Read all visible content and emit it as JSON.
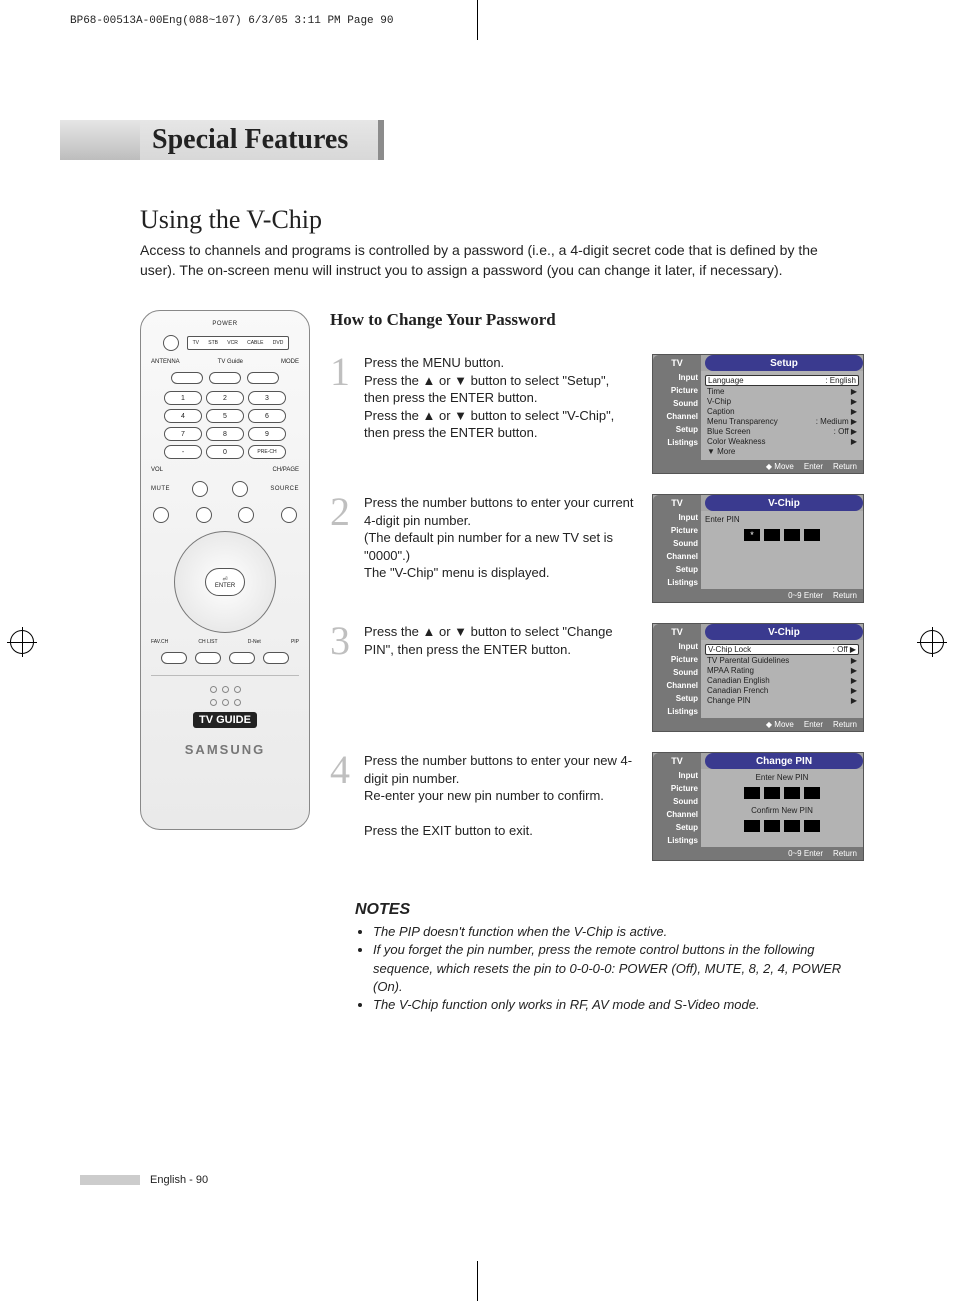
{
  "header": "BP68-00513A-00Eng(088~107)  6/3/05  3:11 PM  Page 90",
  "sectionTitle": "Special Features",
  "subsection": "Using the V-Chip",
  "intro": "Access to channels and programs is controlled by a password (i.e., a 4-digit secret code that is defined by the user). The on-screen menu will instruct you to assign a password (you can change it later, if necessary).",
  "stepsTitle": "How to Change Your Password",
  "steps": [
    {
      "n": "1",
      "text": "Press the MENU button.\nPress the ▲ or ▼ button to select \"Setup\", then press the ENTER button.\nPress the ▲ or ▼ button to select \"V-Chip\", then press the ENTER button."
    },
    {
      "n": "2",
      "text": "Press the number buttons to enter your current 4-digit pin number.\n(The default pin number for a new TV set is \"0000\".)\nThe \"V-Chip\" menu is displayed."
    },
    {
      "n": "3",
      "text": "Press the ▲ or ▼ button to select \"Change PIN\", then press the ENTER button."
    },
    {
      "n": "4",
      "text": "Press the number buttons to enter your new 4-digit pin number.\nRe-enter your new pin number to confirm.\n\nPress the EXIT button to exit."
    }
  ],
  "osd": {
    "sideTabs": [
      "Input",
      "Picture",
      "Sound",
      "Channel",
      "Setup",
      "Listings"
    ],
    "screen1": {
      "tv": "TV",
      "title": "Setup",
      "rows": [
        {
          "l": "Language",
          "r": ": English",
          "sel": true
        },
        {
          "l": "Time",
          "r": "▶"
        },
        {
          "l": "V-Chip",
          "r": "▶"
        },
        {
          "l": "Caption",
          "r": "▶"
        },
        {
          "l": "Menu Transparency",
          "r": ": Medium   ▶"
        },
        {
          "l": "Blue Screen",
          "r": ": Off           ▶"
        },
        {
          "l": "Color Weakness",
          "r": "▶"
        },
        {
          "l": "▼ More",
          "r": ""
        }
      ],
      "footer": [
        "Move",
        "Enter",
        "Return"
      ]
    },
    "screen2": {
      "tv": "TV",
      "title": "V-Chip",
      "label": "Enter PIN",
      "footer": [
        "0~9 Enter",
        "Return"
      ]
    },
    "screen3": {
      "tv": "TV",
      "title": "V-Chip",
      "rows": [
        {
          "l": "V-Chip Lock",
          "r": ": Off          ▶",
          "sel": true
        },
        {
          "l": "TV Parental Guidelines",
          "r": "▶"
        },
        {
          "l": "MPAA Rating",
          "r": "▶"
        },
        {
          "l": "Canadian English",
          "r": "▶"
        },
        {
          "l": "Canadian French",
          "r": "▶"
        },
        {
          "l": "Change PIN",
          "r": "▶"
        }
      ],
      "footer": [
        "Move",
        "Enter",
        "Return"
      ]
    },
    "screen4": {
      "tv": "TV",
      "title": "Change PIN",
      "label1": "Enter New PIN",
      "label2": "Confirm New PIN",
      "footer": [
        "0~9 Enter",
        "Return"
      ]
    }
  },
  "remote": {
    "power": "POWER",
    "selector": [
      "TV",
      "STB",
      "VCR",
      "CABLE",
      "DVD"
    ],
    "row2": [
      "ANTENNA",
      "TV Guide",
      "MODE"
    ],
    "numbers": [
      "1",
      "2",
      "3",
      "4",
      "5",
      "6",
      "7",
      "8",
      "9",
      "-",
      "0",
      "PRE-CH"
    ],
    "volch": [
      "VOL",
      "CH/PAGE"
    ],
    "muteSource": [
      "MUTE",
      "SOURCE"
    ],
    "enter": "ENTER",
    "bottomRow": [
      "FAV.CH",
      "CH LIST",
      "D-Net",
      "PIP"
    ],
    "tvguide": "TV GUIDE",
    "brand": "SAMSUNG"
  },
  "notesTitle": "NOTES",
  "notes": [
    "The PIP doesn't function when the V-Chip is active.",
    "If you forget the pin number, press the remote control buttons in the following sequence, which resets the pin to 0-0-0-0: POWER (Off), MUTE, 8, 2, 4, POWER (On).",
    "The V-Chip function only works in RF, AV mode and S-Video mode."
  ],
  "pageFoot": "English - 90"
}
